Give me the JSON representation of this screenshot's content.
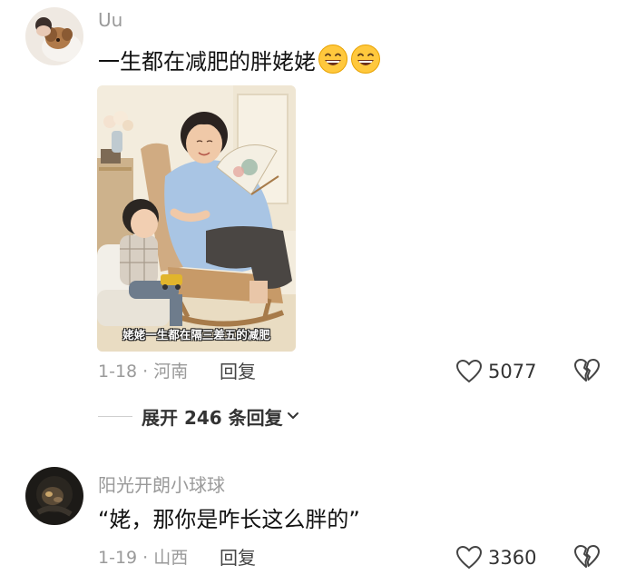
{
  "comments": [
    {
      "username": "Uu",
      "text": "一生都在减肥的胖姥姥",
      "emojis": [
        "grinning-face-emoji",
        "grinning-face-emoji"
      ],
      "image": {
        "caption": "姥姥一生都在隔三差五的减肥"
      },
      "date_location": "1-18 · 河南",
      "reply_label": "回复",
      "like_count": "5077",
      "expand_replies_label": "展开 246 条回复"
    },
    {
      "username": "阳光开朗小球球",
      "text": "“姥，那你是咋长这么胖的”",
      "date_location": "1-19 · 山西",
      "reply_label": "回复",
      "like_count": "3360"
    }
  ],
  "icons": {
    "like": "heart-outline-icon",
    "dislike": "broken-heart-outline-icon",
    "expand": "chevron-down-icon"
  },
  "colors": {
    "text_primary": "#111111",
    "text_secondary": "#9a9a9a",
    "emoji_yellow": "#ffc83d"
  }
}
